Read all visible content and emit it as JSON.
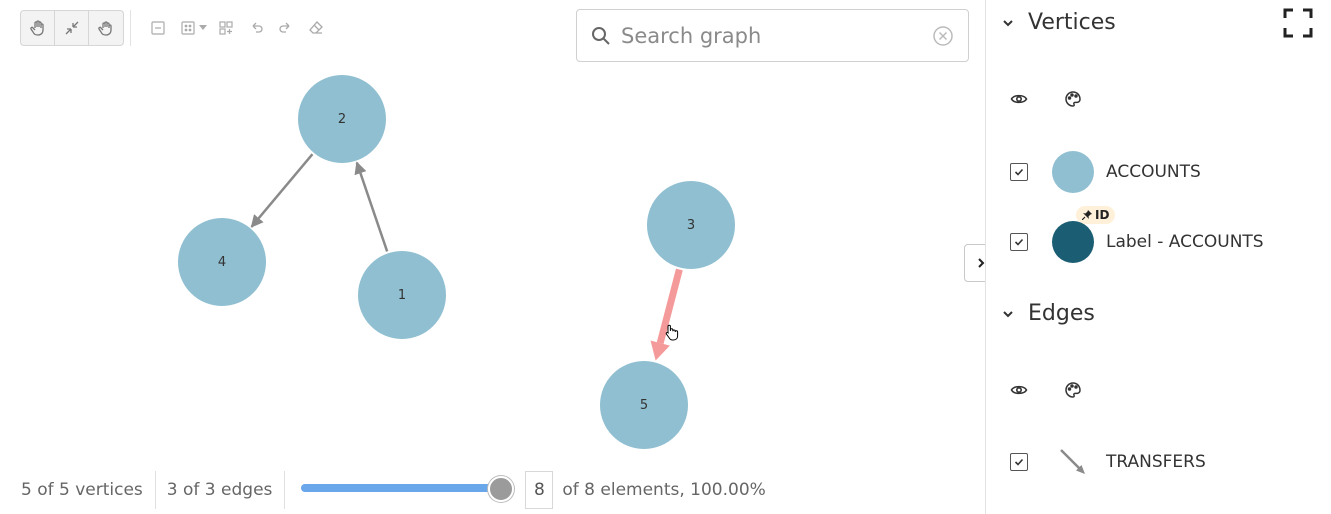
{
  "toolbar": {
    "buttons": [
      "hand-icon",
      "collapse-icon",
      "grab-icon"
    ],
    "actions": [
      "minus-square-icon",
      "grid-icon",
      "dropdown-caret-icon",
      "layout-icon",
      "undo-icon",
      "redo-icon",
      "eraser-icon"
    ]
  },
  "search": {
    "placeholder": "Search graph"
  },
  "graph": {
    "vertices": [
      {
        "id": "2",
        "label": "2"
      },
      {
        "id": "4",
        "label": "4"
      },
      {
        "id": "1",
        "label": "1"
      },
      {
        "id": "3",
        "label": "3"
      },
      {
        "id": "5",
        "label": "5"
      }
    ],
    "edges": [
      {
        "from": "2",
        "to": "4",
        "highlighted": false
      },
      {
        "from": "1",
        "to": "2",
        "highlighted": false
      },
      {
        "from": "3",
        "to": "5",
        "highlighted": true
      }
    ],
    "colors": {
      "vertex": "#8fbfd1",
      "edge": "#8a8a8a",
      "edge_highlight": "#f59a9a"
    }
  },
  "status": {
    "vertices_text": "5 of 5 vertices",
    "edges_text": "3 of 3 edges",
    "slider_fraction": 1.0,
    "element_count": "8",
    "elements_text": "of 8 elements, 100.00%"
  },
  "panel": {
    "vertices_title": "Vertices",
    "edges_title": "Edges",
    "vertex_legend": [
      {
        "label": "ACCOUNTS",
        "color": "#8fbfd1",
        "checked": true
      },
      {
        "label": "Label - ACCOUNTS",
        "color": "#1b5e74",
        "checked": true,
        "badge": "ID"
      }
    ],
    "edge_legend": [
      {
        "label": "TRANSFERS",
        "checked": true
      }
    ]
  }
}
